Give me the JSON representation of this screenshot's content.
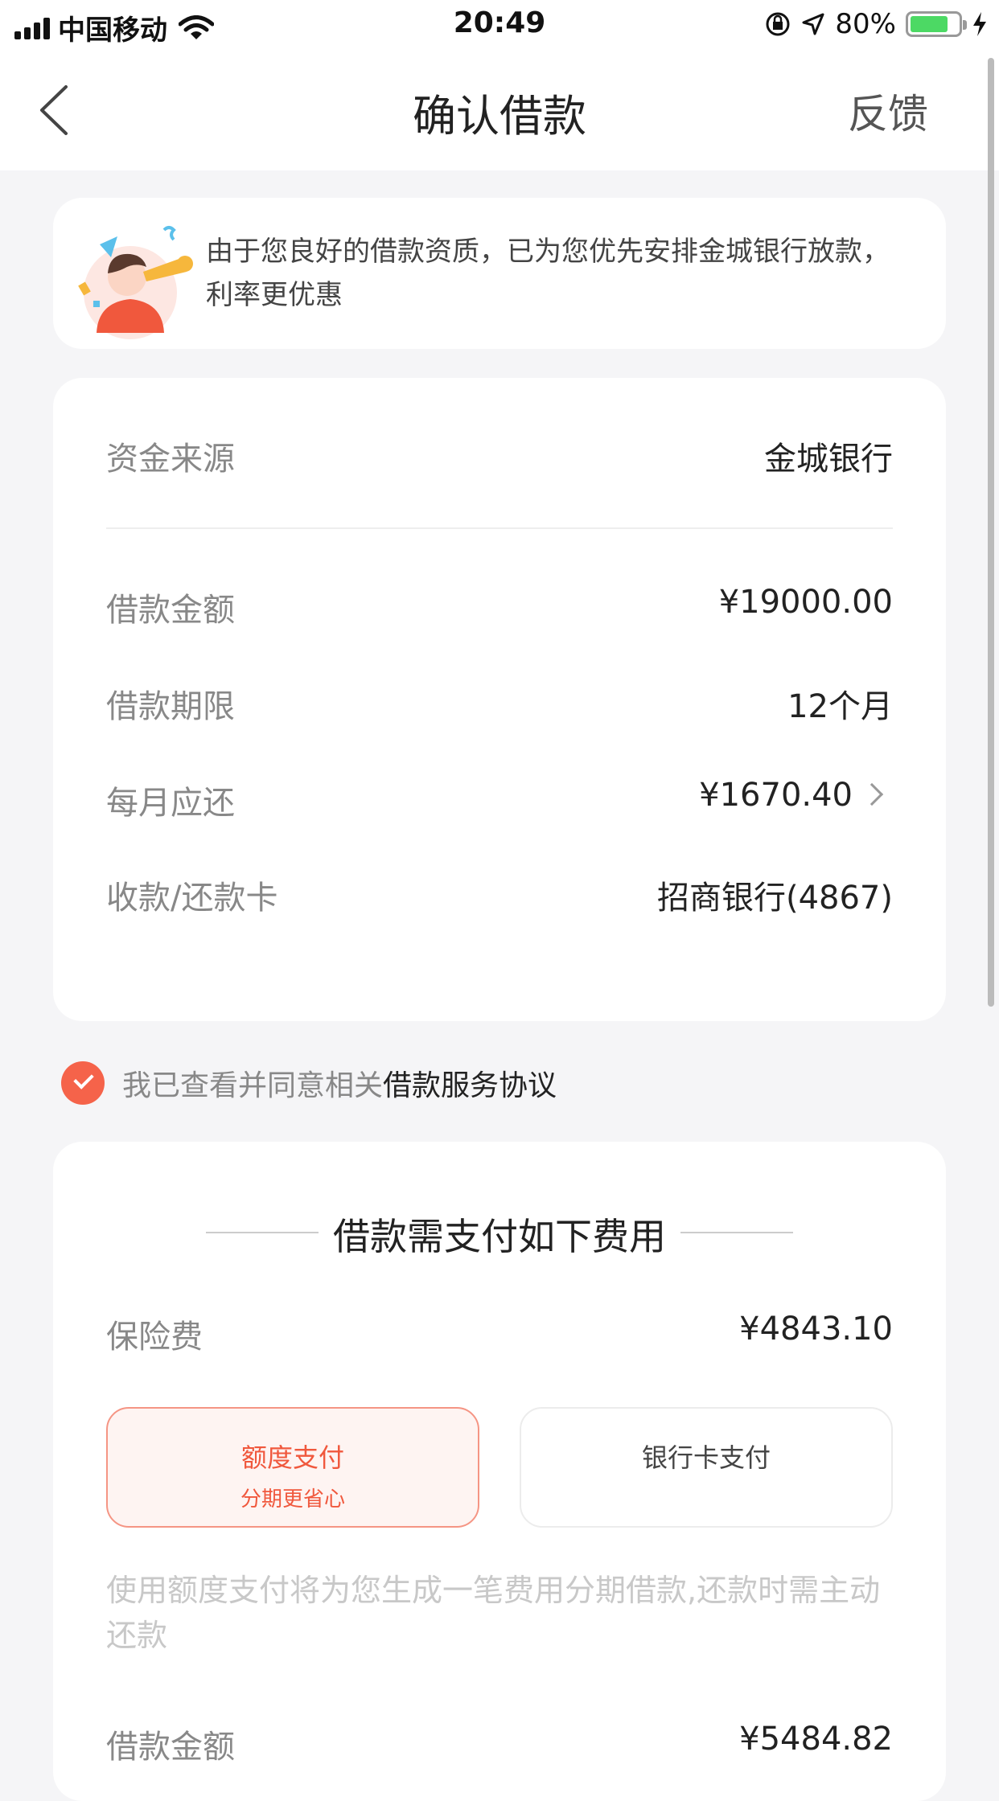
{
  "status": {
    "carrier": "中国移动",
    "time": "20:49",
    "battery": "80%"
  },
  "nav": {
    "title": "确认借款",
    "feedback": "反馈"
  },
  "notice": {
    "text": "由于您良好的借款资质，已为您优先安排金城银行放款，利率更优惠"
  },
  "loan": {
    "source_label": "资金来源",
    "source_value": "金城银行",
    "amount_label": "借款金额",
    "amount_value": "¥19000.00",
    "term_label": "借款期限",
    "term_value": "12个月",
    "monthly_label": "每月应还",
    "monthly_value": "¥1670.40",
    "card_label": "收款/还款卡",
    "card_value": "招商银行(4867)"
  },
  "agreement": {
    "checked": true,
    "prefix": "我已查看并同意相关",
    "link": "借款服务协议"
  },
  "fee": {
    "title": "借款需支付如下费用",
    "insurance_label": "保险费",
    "insurance_value": "¥4843.10",
    "credit_pay_label": "额度支付",
    "credit_pay_sub": "分期更省心",
    "bank_pay_label": "银行卡支付",
    "note": "使用额度支付将为您生成一笔费用分期借款,还款时需主动还款",
    "loan_amount_label": "借款金额",
    "loan_amount_value": "¥5484.82"
  },
  "colors": {
    "accent": "#f5634a",
    "background": "#f5f5f7"
  }
}
